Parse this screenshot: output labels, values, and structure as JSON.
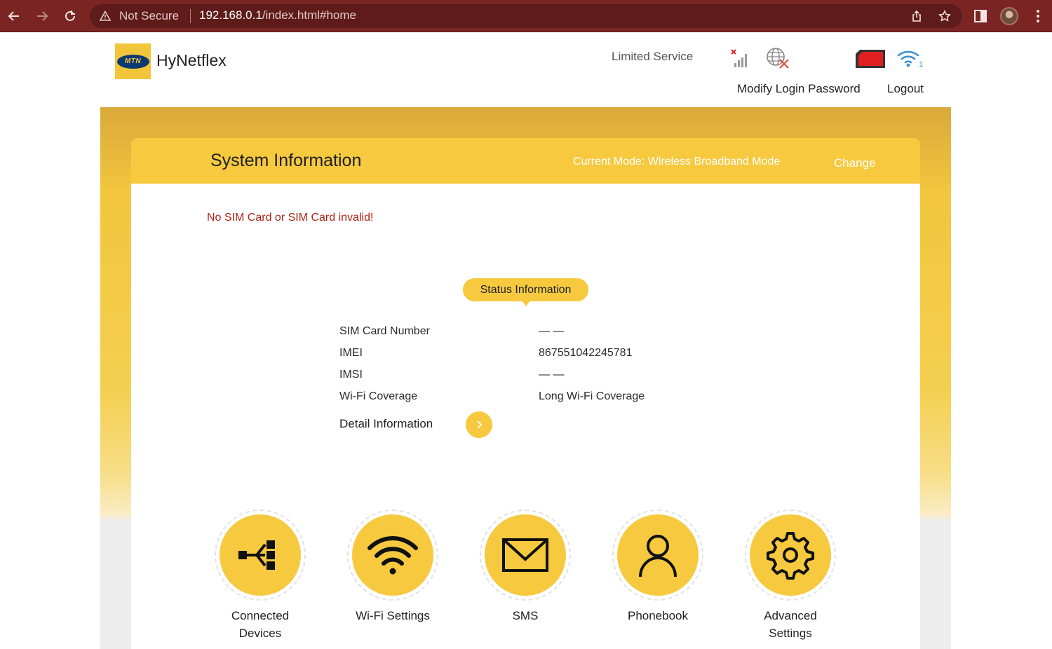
{
  "browser": {
    "security_label": "Not Secure",
    "url_host": "192.168.0.1",
    "url_path": "/index.html#home",
    "icons": [
      "back-icon",
      "forward-icon",
      "reload-icon",
      "warning-icon",
      "share-icon",
      "star-icon",
      "side-panel-icon",
      "avatar",
      "menu-icon"
    ]
  },
  "header": {
    "logo_text": "MTN",
    "brand": "HyNetflex",
    "service_status": "Limited Service",
    "wifi_clients": "1",
    "modify_password": "Modify Login Password",
    "logout": "Logout"
  },
  "main": {
    "title": "System Information",
    "current_mode": "Current Mode: Wireless Broadband Mode",
    "change": "Change",
    "sim_warning": "No SIM Card or SIM Card invalid!",
    "status_title": "Status Information",
    "info": [
      {
        "label": "SIM Card Number",
        "value": "— —"
      },
      {
        "label": "IMEI",
        "value": "867551042245781"
      },
      {
        "label": "IMSI",
        "value": "— —"
      },
      {
        "label": "Wi-Fi Coverage",
        "value": "Long Wi-Fi Coverage"
      }
    ],
    "detail": "Detail Information"
  },
  "tiles": [
    {
      "label": "Connected\nDevices",
      "icon": "network-icon"
    },
    {
      "label": "Wi-Fi Settings",
      "icon": "wifi-icon"
    },
    {
      "label": "SMS",
      "icon": "envelope-icon"
    },
    {
      "label": "Phonebook",
      "icon": "person-icon"
    },
    {
      "label": "Advanced\nSettings",
      "icon": "gear-icon"
    }
  ],
  "colors": {
    "browser_bar": "#7a2524",
    "accent_yellow": "#f6c93f",
    "frame_gold": "#d9a93a",
    "warning_red": "#b02418",
    "sim_red": "#e02020",
    "wifi_blue": "#3a8fd8"
  }
}
